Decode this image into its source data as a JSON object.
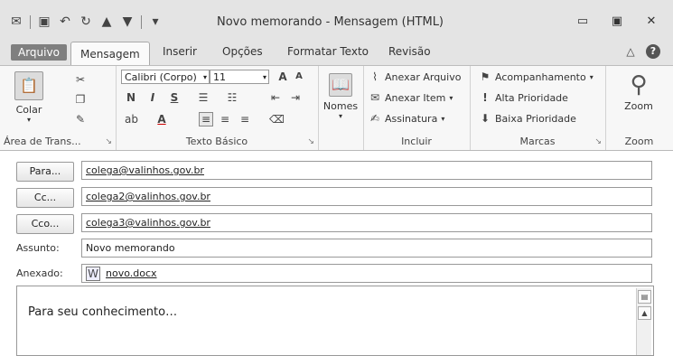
{
  "title": "Novo memorando - Mensagem (HTML)",
  "tabs": [
    "Arquivo",
    "Mensagem",
    "Inserir",
    "Opções",
    "Formatar Texto",
    "Revisão"
  ],
  "active_tab": "Mensagem",
  "ribbon": {
    "clipboard": {
      "paste": "Colar",
      "label": "Área de Trans..."
    },
    "basic_text": {
      "font": "Calibri (Corpo)",
      "size": "11",
      "bold": "N",
      "italic": "I",
      "underline": "S",
      "label": "Texto Básico"
    },
    "names": {
      "label": "Nomes"
    },
    "include": {
      "attach_file": "Anexar Arquivo",
      "attach_item": "Anexar Item",
      "signature": "Assinatura",
      "label": "Incluir"
    },
    "tags": {
      "follow_up": "Acompanhamento",
      "high": "Alta Prioridade",
      "low": "Baixa Prioridade",
      "label": "Marcas"
    },
    "zoom": {
      "button": "Zoom",
      "label": "Zoom"
    }
  },
  "header": {
    "to_label": "Para...",
    "to": "colega@valinhos.gov.br",
    "cc_label": "Cc...",
    "cc": "colega2@valinhos.gov.br",
    "bcc_label": "Cco...",
    "bcc": "colega3@valinhos.gov.br",
    "subject_label": "Assunto:",
    "subject": "Novo memorando",
    "attached_label": "Anexado:",
    "attachment": "novo.docx"
  },
  "body": "Para seu conhecimento…"
}
